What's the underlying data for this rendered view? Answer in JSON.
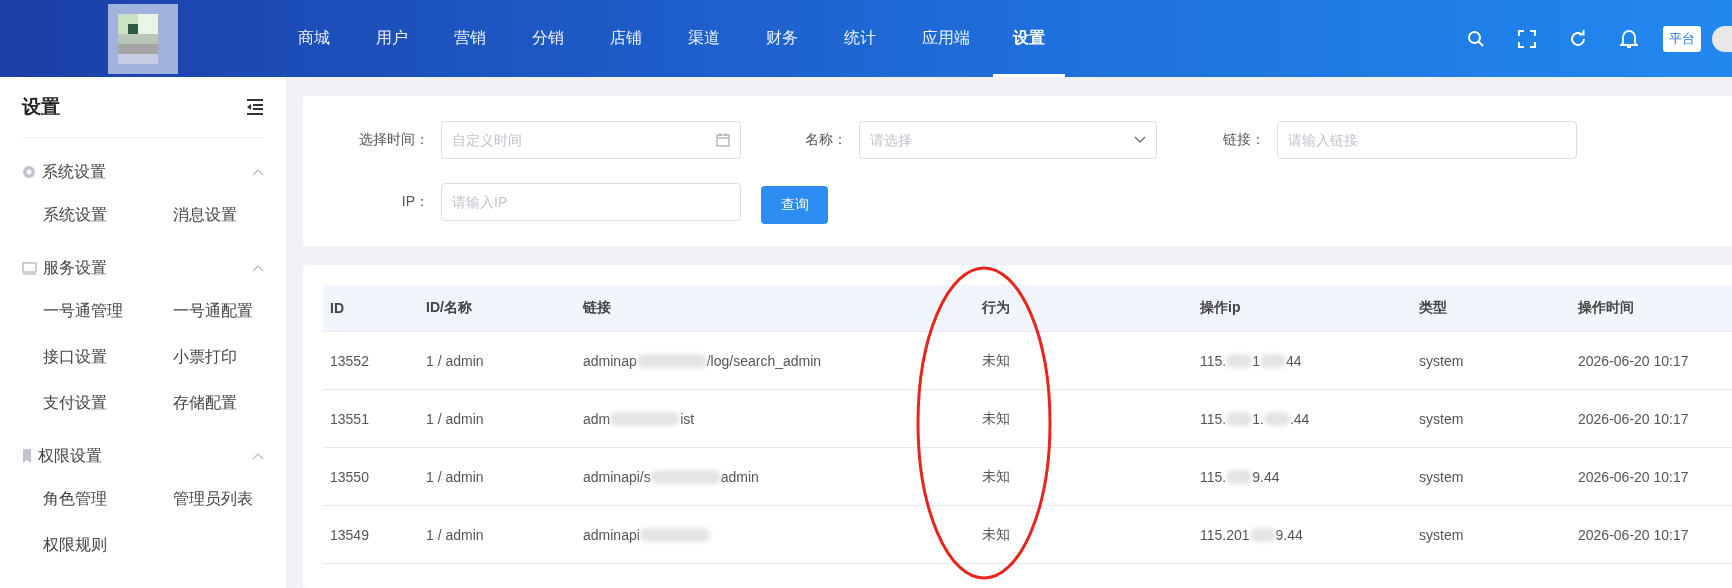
{
  "header": {
    "nav": [
      {
        "label": "商城",
        "selected": false
      },
      {
        "label": "用户",
        "selected": false
      },
      {
        "label": "营销",
        "selected": false
      },
      {
        "label": "分销",
        "selected": false
      },
      {
        "label": "店铺",
        "selected": false
      },
      {
        "label": "渠道",
        "selected": false
      },
      {
        "label": "财务",
        "selected": false
      },
      {
        "label": "统计",
        "selected": false
      },
      {
        "label": "应用端",
        "selected": false
      },
      {
        "label": "设置",
        "selected": true
      }
    ],
    "platform_badge": "平台"
  },
  "sidebar": {
    "title": "设置",
    "groups": [
      {
        "label": "系统设置",
        "expanded": true,
        "items": [
          "系统设置",
          "消息设置"
        ]
      },
      {
        "label": "服务设置",
        "expanded": true,
        "items": [
          "一号通管理",
          "一号通配置",
          "接口设置",
          "小票打印",
          "支付设置",
          "存储配置"
        ]
      },
      {
        "label": "权限设置",
        "expanded": true,
        "items": [
          "角色管理",
          "管理员列表",
          "权限规则"
        ]
      }
    ]
  },
  "filters": [
    {
      "kind": "date",
      "label": "选择时间：",
      "placeholder": "自定义时间"
    },
    {
      "kind": "select",
      "label": "名称：",
      "placeholder": "请选择"
    },
    {
      "kind": "input",
      "label": "链接：",
      "placeholder": "请输入链接"
    },
    {
      "kind": "input",
      "label": "IP：",
      "placeholder": "请输入IP"
    }
  ],
  "query_button": "查询",
  "table": {
    "columns": [
      "ID",
      "ID/名称",
      "链接",
      "行为",
      "操作ip",
      "类型",
      "操作时间"
    ],
    "rows": [
      {
        "id": "13552",
        "name": "1 / admin",
        "link": [
          {
            "kind": "text",
            "text": "adminap"
          },
          {
            "kind": "blur"
          },
          {
            "kind": "text",
            "text": "/log/search_admin"
          }
        ],
        "action": "未知",
        "ip": [
          {
            "kind": "text",
            "text": "115."
          },
          {
            "kind": "blur"
          },
          {
            "kind": "text",
            "text": "1"
          },
          {
            "kind": "blur"
          },
          {
            "kind": "text",
            "text": "44"
          }
        ],
        "type": "system",
        "time": "2026-06-20 10:17"
      },
      {
        "id": "13551",
        "name": "1 / admin",
        "link": [
          {
            "kind": "text",
            "text": "adm"
          },
          {
            "kind": "blur"
          },
          {
            "kind": "text",
            "text": "ist"
          }
        ],
        "action": "未知",
        "ip": [
          {
            "kind": "text",
            "text": "115."
          },
          {
            "kind": "blur"
          },
          {
            "kind": "text",
            "text": "1."
          },
          {
            "kind": "blur"
          },
          {
            "kind": "text",
            "text": ".44"
          }
        ],
        "type": "system",
        "time": "2026-06-20 10:17"
      },
      {
        "id": "13550",
        "name": "1 / admin",
        "link": [
          {
            "kind": "text",
            "text": "adminapi/s"
          },
          {
            "kind": "blur"
          },
          {
            "kind": "text",
            "text": "admin"
          }
        ],
        "action": "未知",
        "ip": [
          {
            "kind": "text",
            "text": "115."
          },
          {
            "kind": "blur"
          },
          {
            "kind": "text",
            "text": "9.44"
          }
        ],
        "type": "system",
        "time": "2026-06-20 10:17"
      },
      {
        "id": "13549",
        "name": "1 / admin",
        "link": [
          {
            "kind": "text",
            "text": "adminapi"
          },
          {
            "kind": "blur"
          }
        ],
        "action": "未知",
        "ip": [
          {
            "kind": "text",
            "text": "115.201"
          },
          {
            "kind": "blur"
          },
          {
            "kind": "text",
            "text": "9.44"
          }
        ],
        "type": "system",
        "time": "2026-06-20 10:17"
      }
    ]
  },
  "annotation": {
    "kind": "ellipse",
    "color": "#e8251c"
  }
}
